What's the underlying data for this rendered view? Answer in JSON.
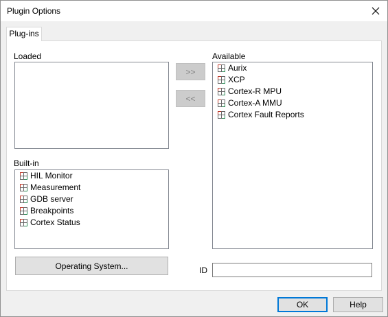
{
  "window": {
    "title": "Plugin Options"
  },
  "tabs": [
    {
      "label": "Plug-ins"
    }
  ],
  "loaded": {
    "label": "Loaded",
    "items": []
  },
  "available": {
    "label": "Available",
    "items": [
      "Aurix",
      "XCP",
      "Cortex-R MPU",
      "Cortex-A MMU",
      "Cortex Fault Reports"
    ]
  },
  "builtin": {
    "label": "Built-in",
    "items": [
      "HIL Monitor",
      "Measurement",
      "GDB server",
      "Breakpoints",
      "Cortex Status"
    ]
  },
  "buttons": {
    "add": ">>",
    "remove": "<<",
    "operating_system": "Operating System...",
    "ok": "OK",
    "help": "Help"
  },
  "id_field": {
    "label": "ID",
    "value": ""
  },
  "icons": {
    "plugin": "plugin-icon",
    "close": "close-icon"
  },
  "colors": {
    "accent": "#0078d7",
    "icon_red": "#c0392b",
    "icon_green": "#2e8b57"
  }
}
